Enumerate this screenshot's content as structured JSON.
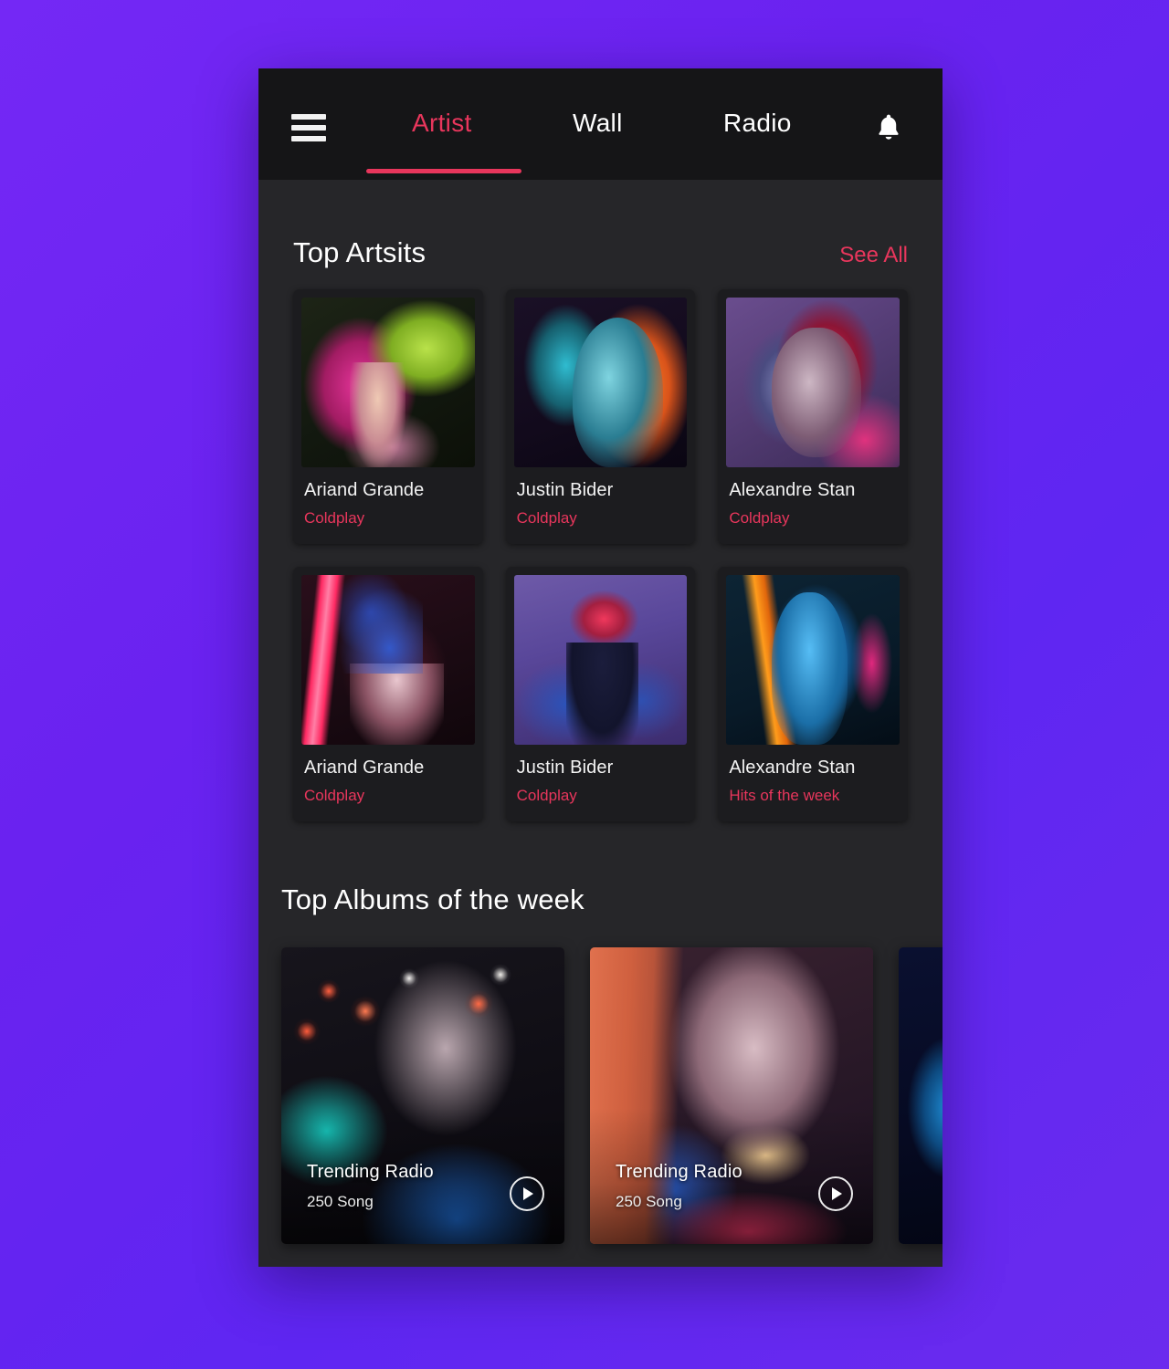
{
  "accent": "#E8365C",
  "background": "#6A22F0",
  "surface": "#262629",
  "card": "#1C1C1F",
  "nav": {
    "menu_icon": "hamburger-menu-icon",
    "bell_icon": "notification-bell-icon",
    "tabs": [
      {
        "label": "Artist",
        "active": true
      },
      {
        "label": "Wall",
        "active": false
      },
      {
        "label": "Radio",
        "active": false
      }
    ]
  },
  "artists": {
    "title": "Top Artsits",
    "see_all": "See All",
    "cards": [
      {
        "name": "Ariand Grande",
        "sub": "Coldplay",
        "art": "ph-1"
      },
      {
        "name": "Justin Bider",
        "sub": "Coldplay",
        "art": "ph-2"
      },
      {
        "name": "Alexandre Stan",
        "sub": "Coldplay",
        "art": "ph-3"
      },
      {
        "name": "Ariand Grande",
        "sub": "Coldplay",
        "art": "ph-4"
      },
      {
        "name": "Justin Bider",
        "sub": "Coldplay",
        "art": "ph-5"
      },
      {
        "name": "Alexandre Stan",
        "sub": "Hits of the week",
        "art": "ph-6"
      }
    ]
  },
  "albums": {
    "title": "Top Albums of the week",
    "cards": [
      {
        "name": "Trending Radio",
        "count": "250 Song",
        "play_icon": "play-icon",
        "art": "art-1"
      },
      {
        "name": "Trending Radio",
        "count": "250 Song",
        "play_icon": "play-icon",
        "art": "art-2"
      },
      {
        "name": "",
        "count": "",
        "play_icon": "",
        "art": "art-3"
      }
    ]
  }
}
